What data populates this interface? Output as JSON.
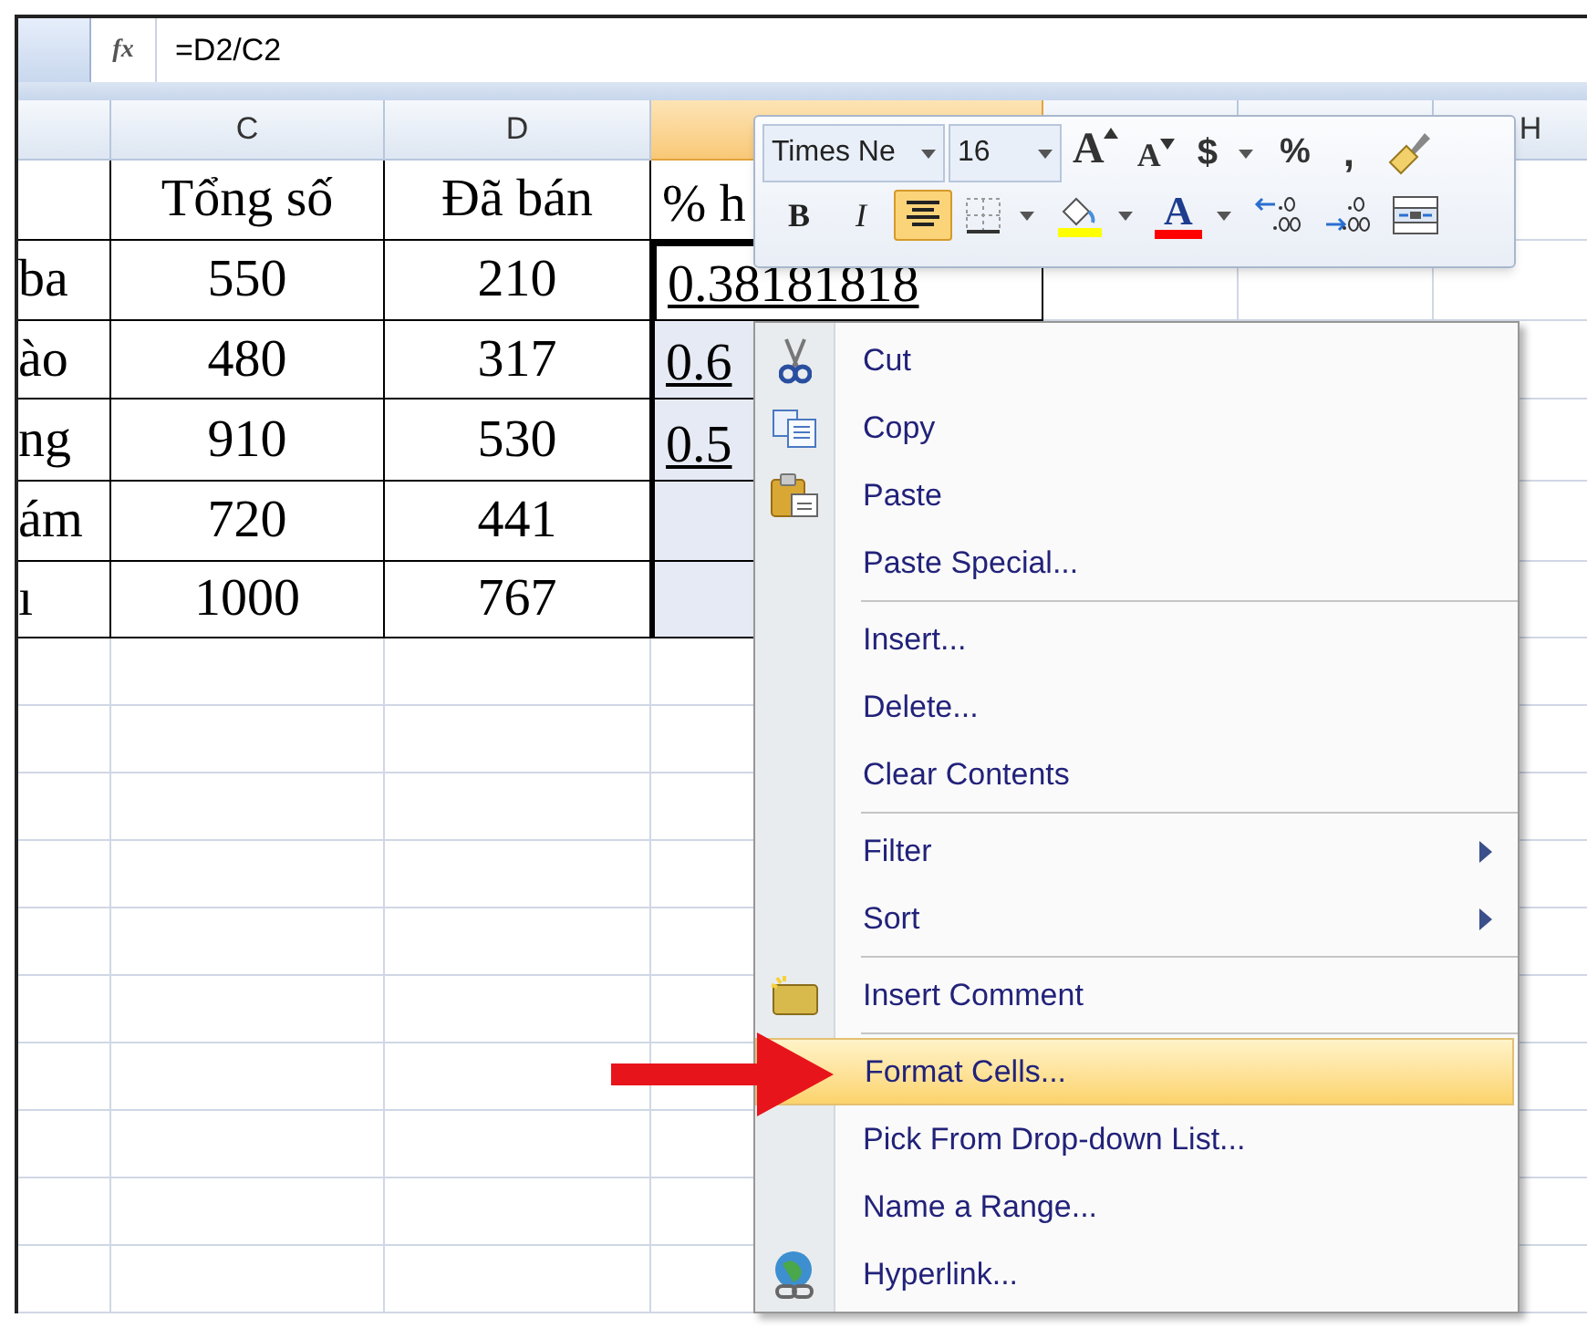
{
  "formula_bar": {
    "fx": "fx",
    "formula": "=D2/C2"
  },
  "column_headers": [
    {
      "selected": false
    },
    {
      "label": "C",
      "selected": false
    },
    {
      "label": "D",
      "selected": false
    },
    {
      "selected": true
    },
    {
      "selected": false
    },
    {
      "selected": false
    },
    {
      "label": "H",
      "selected": false
    }
  ],
  "rows": [
    {
      "total": "Tổng số",
      "sold": "Đã bán",
      "ratio": "% h",
      "selected": false,
      "active": false
    },
    {
      "name": "ba",
      "total": "550",
      "sold": "210",
      "ratio": "0.38181818",
      "selected": true,
      "active": true
    },
    {
      "name": "ào",
      "total": "480",
      "sold": "317",
      "ratio": "0.6",
      "selected": true,
      "active": false
    },
    {
      "name": "ng",
      "total": "910",
      "sold": "530",
      "ratio": "0.5",
      "selected": true,
      "active": false
    },
    {
      "name": "ám",
      "total": "720",
      "sold": "441",
      "selected": true,
      "active": false
    },
    {
      "name": "ı",
      "total": "1000",
      "sold": "767",
      "selected": true,
      "active": false
    }
  ],
  "mini_toolbar": {
    "font": "Times Ne",
    "size": "16",
    "row_1": [
      {
        "kind": "grow",
        "label": "A"
      },
      {
        "kind": "shrink",
        "label": "A"
      },
      {
        "kind": "currency",
        "label": "$"
      },
      {
        "kind": "percent",
        "label": "%"
      },
      {
        "kind": "comma",
        "label": ","
      },
      {
        "kind": "painter"
      }
    ],
    "row_2": [
      {
        "kind": "bold",
        "label": "B",
        "selected": false
      },
      {
        "kind": "italic",
        "label": "I",
        "selected": false
      },
      {
        "kind": "center",
        "selected": true
      },
      {
        "kind": "borders",
        "selected": false
      },
      {
        "kind": "fill",
        "selected": false
      },
      {
        "kind": "fontcolor",
        "label": "A",
        "selected": false
      },
      {
        "kind": "incdec",
        "selected": false
      },
      {
        "kind": "decdec",
        "selected": false
      },
      {
        "kind": "merge",
        "selected": false
      }
    ]
  },
  "context_menu": [
    [
      {
        "label": "Cut",
        "kind": "cut",
        "submenu": false,
        "highlighted": false
      },
      {
        "label": "Copy",
        "kind": "copy",
        "submenu": false,
        "highlighted": false
      },
      {
        "label": "Paste",
        "kind": "paste",
        "submenu": false,
        "highlighted": false
      },
      {
        "label": "Paste Special...",
        "kind": "plain",
        "submenu": false,
        "highlighted": false
      }
    ],
    [
      {
        "label": "Insert...",
        "kind": "plain",
        "submenu": false,
        "highlighted": false
      },
      {
        "label": "Delete...",
        "kind": "plain",
        "submenu": false,
        "highlighted": false
      },
      {
        "label": "Clear Contents",
        "kind": "plain",
        "submenu": false,
        "highlighted": false
      }
    ],
    [
      {
        "label": "Filter",
        "kind": "plain",
        "submenu": true,
        "highlighted": false
      },
      {
        "label": "Sort",
        "kind": "plain",
        "submenu": true,
        "highlighted": false
      }
    ],
    [
      {
        "label": "Insert Comment",
        "kind": "comment",
        "submenu": false,
        "highlighted": false
      }
    ],
    [
      {
        "label": "Format Cells...",
        "kind": "plain",
        "submenu": false,
        "highlighted": true
      },
      {
        "label": "Pick From Drop-down List...",
        "kind": "plain",
        "submenu": false,
        "highlighted": false
      },
      {
        "label": "Name a Range...",
        "kind": "plain",
        "submenu": false,
        "highlighted": false
      },
      {
        "label": "Hyperlink...",
        "kind": "hyperlink",
        "submenu": false,
        "highlighted": false
      }
    ]
  ]
}
